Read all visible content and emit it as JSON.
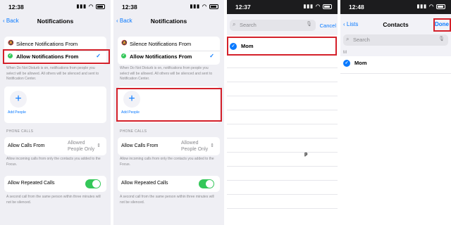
{
  "panel1": {
    "time": "12:38",
    "back": "Back",
    "title": "Notifications",
    "silence_label": "Silence Notifications From",
    "allow_label": "Allow Notifications From",
    "footnote": "When Do Not Disturb is on, notifications from people you select will be allowed. All others will be silenced and sent to Notification Center.",
    "add_people": "Add People",
    "phone_calls_header": "PHONE CALLS",
    "allow_calls_label": "Allow Calls From",
    "allow_calls_value_line1": "Allowed",
    "allow_calls_value_line2": "People Only",
    "calls_footnote": "Allow incoming calls from only the contacts you added to the Focus.",
    "repeated_label": "Allow Repeated Calls",
    "repeated_footnote": "A second call from the same person within three minutes will not be silenced."
  },
  "panel2": {
    "time": "12:38",
    "back": "Back",
    "title": "Notifications",
    "silence_label": "Silence Notifications From",
    "allow_label": "Allow Notifications From",
    "footnote": "When Do Not Disturb is on, notifications from people you select will be allowed. All others will be silenced and sent to Notification Center.",
    "add_people": "Add People",
    "phone_calls_header": "PHONE CALLS",
    "allow_calls_label": "Allow Calls From",
    "allow_calls_value_line1": "Allowed",
    "allow_calls_value_line2": "People Only",
    "calls_footnote": "Allow incoming calls from only the contacts you added to the Focus.",
    "repeated_label": "Allow Repeated Calls",
    "repeated_footnote": "A second call from the same person within three minutes will not be silenced."
  },
  "panel3": {
    "time": "12:37",
    "search_placeholder": "Search",
    "cancel": "Cancel",
    "contact_name": "Mom",
    "index_letter": "p"
  },
  "panel4": {
    "time": "12:48",
    "back": "Lists",
    "title": "Contacts",
    "done": "Done",
    "search_placeholder": "Search",
    "section_letter": "M",
    "contact_name": "Mom"
  },
  "colors": {
    "ios_blue": "#0a7aff",
    "ios_green": "#34c759",
    "highlight_red": "#d4202a"
  }
}
